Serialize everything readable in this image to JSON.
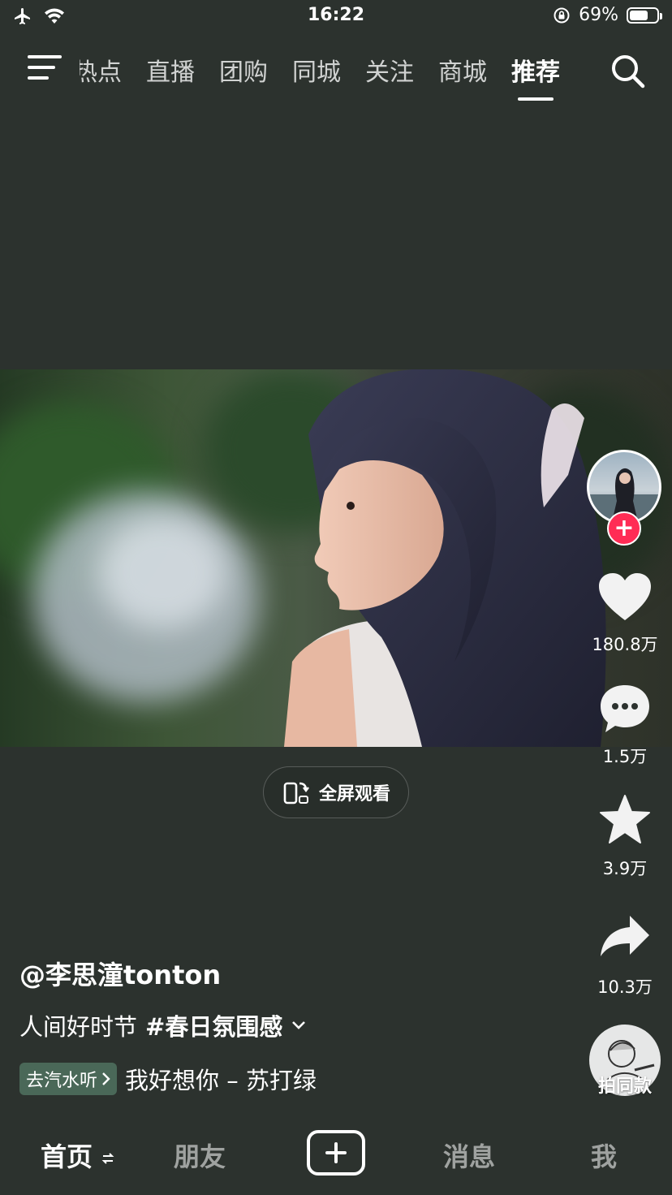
{
  "status_bar": {
    "time": "16:22",
    "battery": "69%",
    "battery_level": 0.69
  },
  "top_nav": {
    "tabs": [
      "热点",
      "直播",
      "团购",
      "同城",
      "关注",
      "商城",
      "推荐"
    ],
    "active_tab": "推荐"
  },
  "video": {
    "fullscreen_label": "全屏观看"
  },
  "actions": {
    "likes": "180.8万",
    "comments": "1.5万",
    "favorites": "3.9万",
    "shares": "10.3万",
    "same_style": "拍同款"
  },
  "post": {
    "username": "@李思潼tonton",
    "caption_text": "人间好时节",
    "caption_tag": "#春日氛围感",
    "music_badge": "去汽水听",
    "music_title": "我好想你 – 苏打绿"
  },
  "bottom_nav": {
    "home": "首页",
    "friends": "朋友",
    "messages": "消息",
    "me": "我"
  },
  "colors": {
    "background": "#2c322e",
    "follow_accent": "#ff2c55"
  }
}
